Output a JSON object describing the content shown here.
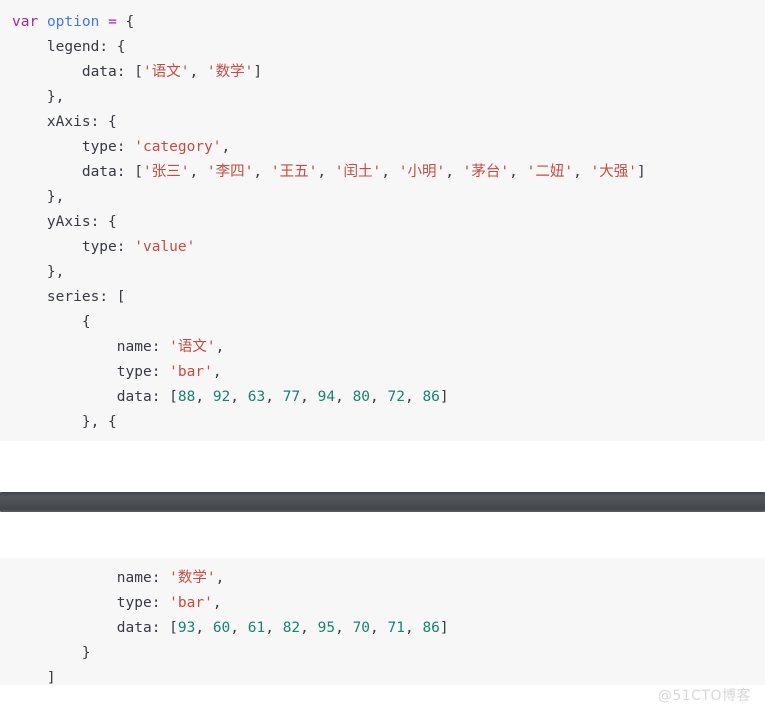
{
  "editor": {
    "language": "javascript",
    "background_color": "#f7f7f8",
    "page_background_color": "#ffffff",
    "colors": {
      "keyword": "#a626a4",
      "variable": "#4078f2",
      "operator": "#a626a4",
      "punctuation": "#383a42",
      "property": "#383a42",
      "string": "#c94a3e",
      "number": "#1a8271",
      "scrollbar": "#4c5155",
      "watermark": "#d8d8da"
    }
  },
  "code": {
    "option_data": {
      "legend_data": [
        "语文",
        "数学"
      ],
      "xaxis_type": "category",
      "xaxis_data": [
        "张三",
        "李四",
        "王五",
        "闰土",
        "小明",
        "茅台",
        "二妞",
        "大强"
      ],
      "yaxis_type": "value",
      "series": [
        {
          "name": "语文",
          "type": "bar",
          "data": [
            88,
            92,
            63,
            77,
            94,
            80,
            72,
            86
          ]
        },
        {
          "name": "数学",
          "type": "bar",
          "data": [
            93,
            60,
            61,
            82,
            95,
            70,
            71,
            86
          ]
        }
      ]
    },
    "block_top": {
      "l1": {
        "kw": "var",
        "var": "option",
        "op": "=",
        "punc": "{"
      },
      "l2": {
        "key": "legend",
        "punc": ": {"
      },
      "l3": {
        "key": "data",
        "colon": ": [",
        "s1": "'语文'",
        "comma": ", ",
        "s2": "'数学'",
        "close": "]"
      },
      "l4": {
        "punc": "},"
      },
      "l5": {
        "key": "xAxis",
        "punc": ": {"
      },
      "l6": {
        "key": "type",
        "colon": ": ",
        "str": "'category'",
        "comma": ","
      },
      "l7": {
        "key": "data",
        "colon": ": [",
        "s1": "'张三'",
        "s2": "'李四'",
        "s3": "'王五'",
        "s4": "'闰土'",
        "s5": "'小明'",
        "s6": "'茅台'",
        "s7": "'二妞'",
        "s8": "'大强'",
        "sep": ", ",
        "close": "]"
      },
      "l8": {
        "punc": "},"
      },
      "l9": {
        "key": "yAxis",
        "punc": ": {"
      },
      "l10": {
        "key": "type",
        "colon": ": ",
        "str": "'value'"
      },
      "l11": {
        "punc": "},"
      },
      "l12": {
        "key": "series",
        "punc": ": ["
      },
      "l13": {
        "punc": "{"
      },
      "l14": {
        "key": "name",
        "colon": ": ",
        "str": "'语文'",
        "comma": ","
      },
      "l15": {
        "key": "type",
        "colon": ": ",
        "str": "'bar'",
        "comma": ","
      },
      "l16": {
        "key": "data",
        "colon": ": [",
        "n1": "88",
        "n2": "92",
        "n3": "63",
        "n4": "77",
        "n5": "94",
        "n6": "80",
        "n7": "72",
        "n8": "86",
        "sep": ", ",
        "close": "]"
      },
      "l17": {
        "punc": "}, {"
      }
    },
    "block_bottom": {
      "l1": {
        "key": "name",
        "colon": ": ",
        "str": "'数学'",
        "comma": ","
      },
      "l2": {
        "key": "type",
        "colon": ": ",
        "str": "'bar'",
        "comma": ","
      },
      "l3": {
        "key": "data",
        "colon": ": [",
        "n1": "93",
        "n2": "60",
        "n3": "61",
        "n4": "82",
        "n5": "95",
        "n6": "70",
        "n7": "71",
        "n8": "86",
        "sep": ", ",
        "close": "]"
      },
      "l4": {
        "punc": "}"
      },
      "l5": {
        "punc": "]"
      },
      "l6": {
        "punc": "}"
      }
    }
  },
  "watermark": {
    "text": "@51CTO博客"
  }
}
